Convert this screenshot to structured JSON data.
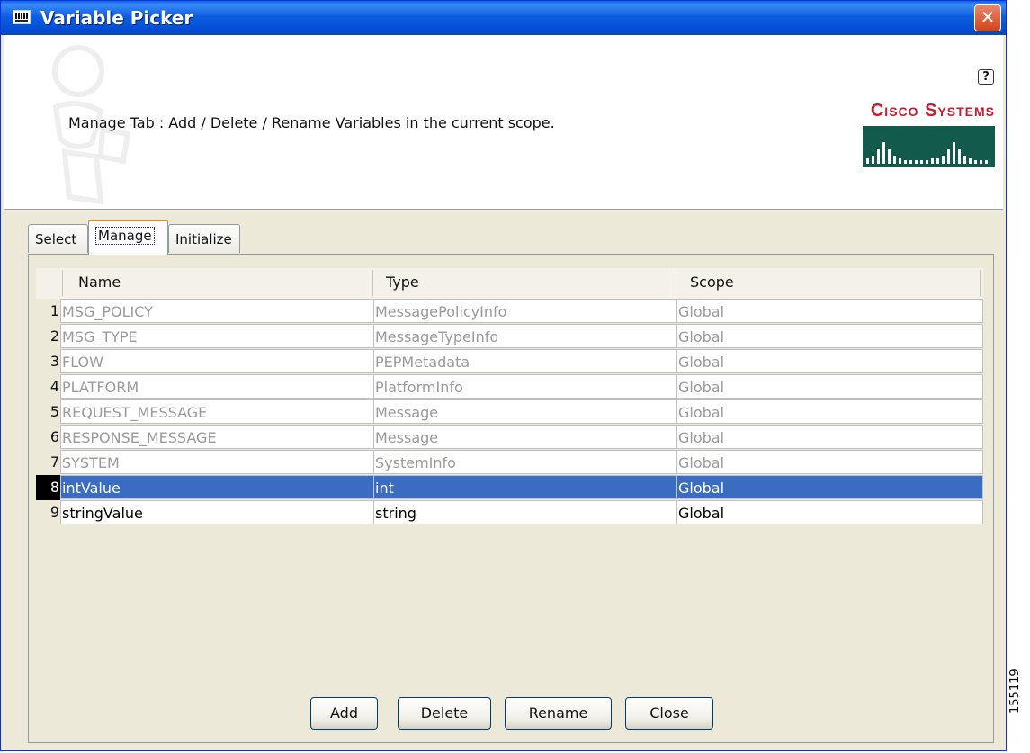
{
  "window": {
    "title": "Variable Picker",
    "close_icon": "✕"
  },
  "header": {
    "description": "Manage Tab : Add / Delete / Rename Variables in the current scope.",
    "help_icon": "?",
    "logo_text": "Cisco Systems"
  },
  "tabs": [
    {
      "label": "Select",
      "active": false
    },
    {
      "label": "Manage",
      "active": true
    },
    {
      "label": "Initialize",
      "active": false
    }
  ],
  "table": {
    "columns": [
      "Name",
      "Type",
      "Scope"
    ],
    "rows": [
      {
        "num": "1",
        "name": "MSG_POLICY",
        "type": "MessagePolicyInfo",
        "scope": "Global",
        "state": "dim"
      },
      {
        "num": "2",
        "name": "MSG_TYPE",
        "type": "MessageTypeInfo",
        "scope": "Global",
        "state": "dim"
      },
      {
        "num": "3",
        "name": "FLOW",
        "type": "PEPMetadata",
        "scope": "Global",
        "state": "dim"
      },
      {
        "num": "4",
        "name": "PLATFORM",
        "type": "PlatformInfo",
        "scope": "Global",
        "state": "dim"
      },
      {
        "num": "5",
        "name": "REQUEST_MESSAGE",
        "type": "Message",
        "scope": "Global",
        "state": "dim"
      },
      {
        "num": "6",
        "name": "RESPONSE_MESSAGE",
        "type": "Message",
        "scope": "Global",
        "state": "dim"
      },
      {
        "num": "7",
        "name": "SYSTEM",
        "type": "SystemInfo",
        "scope": "Global",
        "state": "dim"
      },
      {
        "num": "8",
        "name": "intValue",
        "type": "int",
        "scope": "Global",
        "state": "selected"
      },
      {
        "num": "9",
        "name": "stringValue",
        "type": "string",
        "scope": "Global",
        "state": "normal"
      }
    ]
  },
  "buttons": {
    "add": "Add",
    "delete": "Delete",
    "rename": "Rename",
    "close": "Close"
  },
  "figure_code": "155119",
  "colors": {
    "titlebar": "#0250d6",
    "selection": "#3a6cc2",
    "cisco_red": "#c41e2e",
    "cisco_green": "#115a4c"
  }
}
